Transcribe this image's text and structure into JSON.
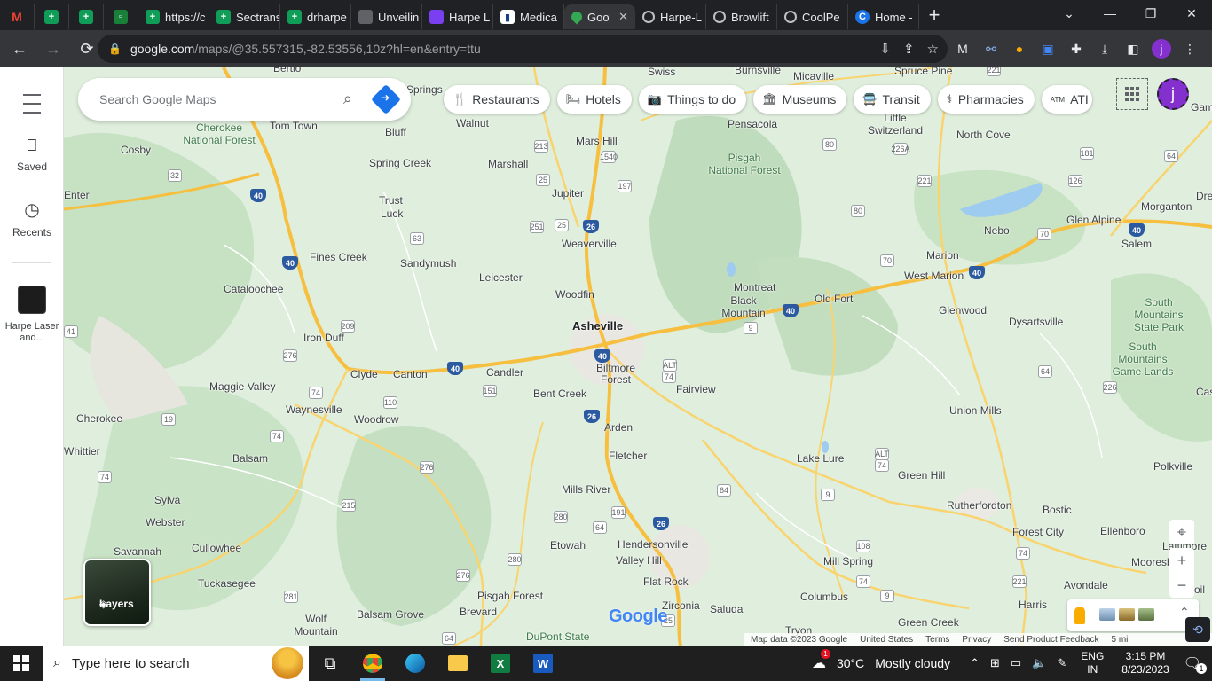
{
  "browser": {
    "tabs": [
      {
        "label": "",
        "icon": "gmail-icon",
        "pinned": true
      },
      {
        "label": "",
        "icon": "sheets-icon",
        "pinned": true
      },
      {
        "label": "",
        "icon": "sheets-icon",
        "pinned": true
      },
      {
        "label": "",
        "icon": "sheets-icon",
        "pinned": true
      },
      {
        "label": "https://c",
        "icon": "sheets-icon"
      },
      {
        "label": "Sectrans",
        "icon": "sheets-icon"
      },
      {
        "label": "drharpe",
        "icon": "sheets-icon"
      },
      {
        "label": "Unveilin",
        "icon": "page-icon"
      },
      {
        "label": "Harpe L",
        "icon": "purple-app-icon"
      },
      {
        "label": "Medica",
        "icon": "doc-icon"
      },
      {
        "label": "Goo",
        "icon": "maps-icon",
        "active": true
      },
      {
        "label": "Harpe-L",
        "icon": "globe-icon"
      },
      {
        "label": "Browlift",
        "icon": "globe-icon"
      },
      {
        "label": "CoolPe",
        "icon": "globe-icon"
      },
      {
        "label": "Home -",
        "icon": "c-logo-icon"
      }
    ],
    "url_host": "google.com",
    "url_path": "/maps/@35.557315,-82.53556,10z?hl=en&entry=ttu",
    "profile_letter": "j"
  },
  "maps": {
    "rail": {
      "saved_label": "Saved",
      "recents_label": "Recents",
      "recent_place_label": "Harpe Laser and..."
    },
    "search_placeholder": "Search Google Maps",
    "chips": [
      {
        "label": "Restaurants",
        "icon": "fork-knife-icon"
      },
      {
        "label": "Hotels",
        "icon": "bed-icon"
      },
      {
        "label": "Things to do",
        "icon": "camera-icon"
      },
      {
        "label": "Museums",
        "icon": "museum-icon"
      },
      {
        "label": "Transit",
        "icon": "bus-icon"
      },
      {
        "label": "Pharmacies",
        "icon": "pharmacy-icon"
      },
      {
        "label": "ATI",
        "icon": "atm-icon"
      }
    ],
    "avatar_letter": "j",
    "layers_label": "Layers",
    "logo_text": "Google",
    "footer": {
      "map_data": "Map data ©2023 Google",
      "country": "United States",
      "terms": "Terms",
      "privacy": "Privacy",
      "feedback": "Send Product Feedback",
      "scale": "5 mi"
    },
    "places": [
      {
        "name": "Cosby"
      },
      {
        "name": "Tom Town"
      },
      {
        "name": "Cherokee National Forest"
      },
      {
        "name": "Bluff"
      },
      {
        "name": "Spring Creek"
      },
      {
        "name": "Walnut"
      },
      {
        "name": "Marshall"
      },
      {
        "name": "Mars Hill"
      },
      {
        "name": "Jupiter"
      },
      {
        "name": "Trust"
      },
      {
        "name": "Luck"
      },
      {
        "name": "Weaverville"
      },
      {
        "name": "Sandymush"
      },
      {
        "name": "Fines Creek"
      },
      {
        "name": "Leicester"
      },
      {
        "name": "Cataloochee"
      },
      {
        "name": "Woodfin"
      },
      {
        "name": "Asheville"
      },
      {
        "name": "Iron Duff"
      },
      {
        "name": "Maggie Valley"
      },
      {
        "name": "Clyde"
      },
      {
        "name": "Canton"
      },
      {
        "name": "Candler"
      },
      {
        "name": "Biltmore Forest"
      },
      {
        "name": "Bent Creek"
      },
      {
        "name": "Fairview"
      },
      {
        "name": "Waynesville"
      },
      {
        "name": "Woodrow"
      },
      {
        "name": "Cherokee"
      },
      {
        "name": "Balsam"
      },
      {
        "name": "Arden"
      },
      {
        "name": "Fletcher"
      },
      {
        "name": "Mills River"
      },
      {
        "name": "Sylva"
      },
      {
        "name": "Webster"
      },
      {
        "name": "Cullowhee"
      },
      {
        "name": "Savannah"
      },
      {
        "name": "Etowah"
      },
      {
        "name": "Hendersonville"
      },
      {
        "name": "Valley Hill"
      },
      {
        "name": "Tuckasegee"
      },
      {
        "name": "Flat Rock"
      },
      {
        "name": "Pisgah Forest"
      },
      {
        "name": "Brevard"
      },
      {
        "name": "Zirconia"
      },
      {
        "name": "Saluda"
      },
      {
        "name": "Balsam Grove"
      },
      {
        "name": "Wolf Mountain"
      },
      {
        "name": "DuPont State"
      },
      {
        "name": "Tryon"
      },
      {
        "name": "Pensacola"
      },
      {
        "name": "Pisgah National Forest"
      },
      {
        "name": "Micaville"
      },
      {
        "name": "Burnsville"
      },
      {
        "name": "Swiss"
      },
      {
        "name": "Spruce Pine"
      },
      {
        "name": "Little Switzerland"
      },
      {
        "name": "North Cove"
      },
      {
        "name": "Montreat"
      },
      {
        "name": "Black Mountain"
      },
      {
        "name": "Old Fort"
      },
      {
        "name": "Marion"
      },
      {
        "name": "West Marion"
      },
      {
        "name": "Nebo"
      },
      {
        "name": "Glen Alpine"
      },
      {
        "name": "Morganton"
      },
      {
        "name": "Salem"
      },
      {
        "name": "Glenwood"
      },
      {
        "name": "Dysartsville"
      },
      {
        "name": "South Mountains State Park"
      },
      {
        "name": "South Mountains Game Lands"
      },
      {
        "name": "Union Mills"
      },
      {
        "name": "Lake Lure"
      },
      {
        "name": "Green Hill"
      },
      {
        "name": "Rutherfordton"
      },
      {
        "name": "Bostic"
      },
      {
        "name": "Forest City"
      },
      {
        "name": "Ellenboro"
      },
      {
        "name": "Mill Spring"
      },
      {
        "name": "Columbus"
      },
      {
        "name": "Polkville"
      },
      {
        "name": "Avondale"
      },
      {
        "name": "Harris"
      },
      {
        "name": "Green Creek"
      },
      {
        "name": "Mooresboro"
      },
      {
        "name": "Lattimore"
      },
      {
        "name": "Springs"
      },
      {
        "name": "Enter"
      },
      {
        "name": "Whittier"
      },
      {
        "name": "Drex"
      },
      {
        "name": "Casar"
      },
      {
        "name": "Boil"
      },
      {
        "name": "Gam"
      },
      {
        "name": "Bertio"
      }
    ]
  },
  "taskbar": {
    "search_placeholder": "Type here to search",
    "weather_temp": "30°C",
    "weather_text": "Mostly cloudy",
    "lang1": "ENG",
    "lang2": "IN",
    "time": "3:15 PM",
    "date": "8/23/2023",
    "notification_count": "1"
  },
  "colors": {
    "maps_blue": "#1a73e8",
    "profile_purple": "#8430ce",
    "map_land": "#dfeedd",
    "map_forest": "#c5e0c2",
    "highway": "#f9c74f"
  }
}
